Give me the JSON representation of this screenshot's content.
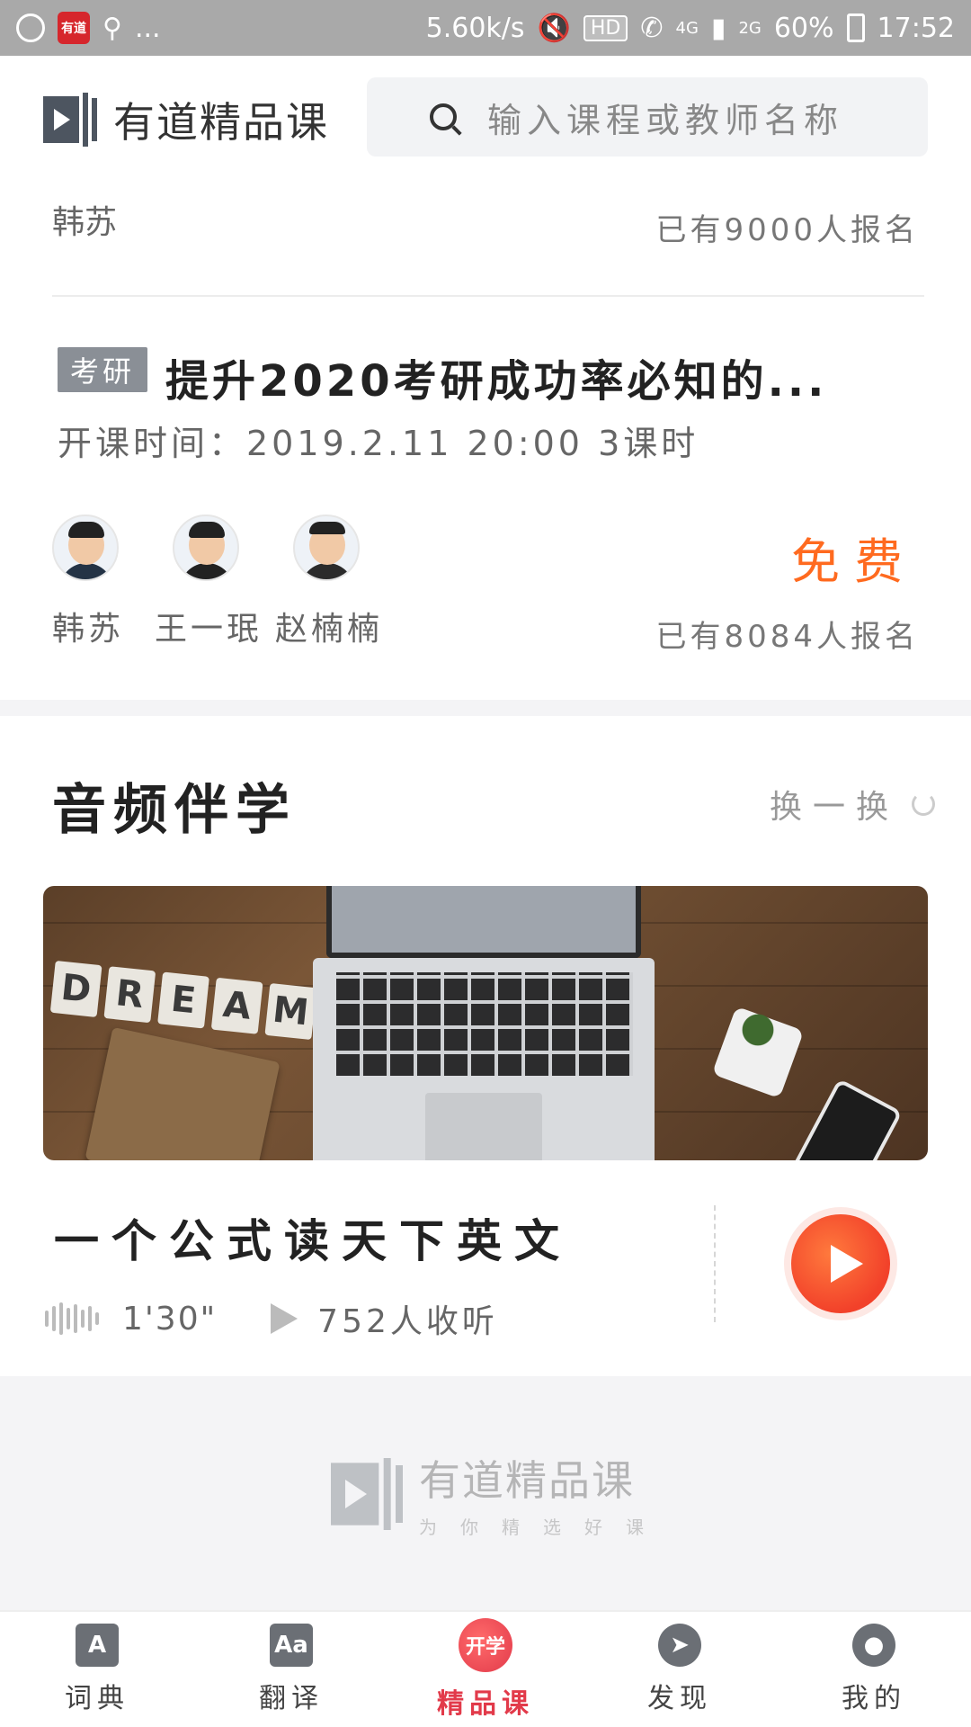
{
  "status_bar": {
    "app_icon": "有道",
    "ellipsis": "...",
    "speed": "5.60k/s",
    "hd": "HD",
    "network": "4G",
    "network2": "2G",
    "battery": "60%",
    "time": "17:52"
  },
  "header": {
    "logo_text": "有道精品课",
    "search_placeholder": "输入课程或教师名称"
  },
  "previous_course": {
    "teacher": "韩苏",
    "enroll_count": "已有9000人报名"
  },
  "course": {
    "tag": "考研",
    "title": "提升2020考研成功率必知的...",
    "time": "开课时间：2019.2.11 20:00   3课时",
    "teachers": [
      "韩苏",
      "王一珉",
      "赵楠楠"
    ],
    "price": "免费",
    "enroll_count": "已有8084人报名"
  },
  "audio_section": {
    "title": "音频伴学",
    "swap_label": "换一换",
    "banner_word": "DREAM",
    "track_title": "一个公式读天下英文",
    "duration": "1'30\"",
    "listeners": "752人收听"
  },
  "footer": {
    "brand": "有道精品课",
    "slogan": "为你精选好课"
  },
  "bottom_nav": {
    "items": [
      {
        "label": "词典",
        "icon": "A"
      },
      {
        "label": "翻译",
        "icon": "Aa"
      },
      {
        "label": "精品课",
        "icon": "开学"
      },
      {
        "label": "发现",
        "icon": "compass"
      },
      {
        "label": "我的",
        "icon": "person"
      }
    ],
    "active_index": 2
  },
  "colors": {
    "accent": "#e23a4a",
    "price": "#ff6a1f",
    "play": "#f2412a"
  }
}
